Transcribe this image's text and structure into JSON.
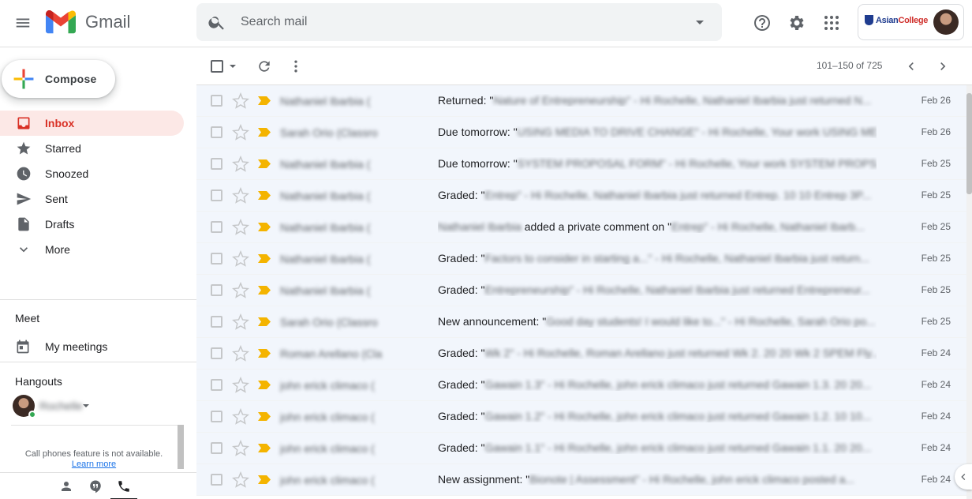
{
  "header": {
    "app_name": "Gmail",
    "search_placeholder": "Search mail",
    "org_logo_blue": "Asian",
    "org_logo_red": "College"
  },
  "sidebar": {
    "compose_label": "Compose",
    "items": [
      {
        "label": "Inbox",
        "icon": "inbox-icon",
        "active": true
      },
      {
        "label": "Starred",
        "icon": "star-icon"
      },
      {
        "label": "Snoozed",
        "icon": "clock-icon"
      },
      {
        "label": "Sent",
        "icon": "send-icon"
      },
      {
        "label": "Drafts",
        "icon": "draft-icon"
      },
      {
        "label": "More",
        "icon": "chevron-down-icon"
      }
    ],
    "meet_title": "Meet",
    "meet_item": "My meetings",
    "hangouts_title": "Hangouts",
    "hangouts_user": "Rochelle",
    "phone_message": "Call phones feature is not available.",
    "phone_link": "Learn more"
  },
  "toolbar": {
    "pagination": "101–150 of 725"
  },
  "emails": [
    {
      "sender": "Nathaniel Ibarbia (",
      "prefix": "Returned: \"",
      "blurred": "Nature of Entrepreneurship\" - Hi Rochelle, Nathaniel Ibarbia just returned N...",
      "suffix": "",
      "date": "Feb 26"
    },
    {
      "sender": "Sarah Orio (Classro",
      "prefix": "Due tomorrow: \"",
      "blurred": "USING MEDIA TO DRIVE CHANGE\" - Hi Rochelle, Your work USING ME...",
      "suffix": "",
      "date": "Feb 26"
    },
    {
      "sender": "Nathaniel Ibarbia (",
      "prefix": "Due tomorrow: \"",
      "blurred": "SYSTEM PROPOSAL FORM\" - Hi Rochelle, Your work SYSTEM PROPS...",
      "suffix": "",
      "date": "Feb 25"
    },
    {
      "sender": "Nathaniel Ibarbia (",
      "prefix": "Graded: \"",
      "blurred": "Entrep\" - Hi Rochelle, Nathaniel Ibarbia just returned Entrep. 10 10 Entrep 3P...",
      "suffix": "",
      "date": "Feb 25"
    },
    {
      "sender": "Nathaniel Ibarbia (",
      "prefix": "",
      "blurred": "Nathaniel Ibarbia",
      "suffix": " added a private comment on \"",
      "tail": "Entrep\" - Hi Rochelle, Nathaniel Ibarb...",
      "date": "Feb 25"
    },
    {
      "sender": "Nathaniel Ibarbia (",
      "prefix": "Graded: \"",
      "blurred": "Factors to consider in starting a...\" - Hi Rochelle, Nathaniel Ibarbia just return...",
      "suffix": "",
      "date": "Feb 25"
    },
    {
      "sender": "Nathaniel Ibarbia (",
      "prefix": "Graded: \"",
      "blurred": "Entrepreneurship\" - Hi Rochelle, Nathaniel Ibarbia just returned Entrepreneur...",
      "suffix": "",
      "date": "Feb 25"
    },
    {
      "sender": "Sarah Orio (Classro",
      "prefix": "New announcement: \"",
      "blurred": "Good day students! I would like to...\" - Hi Rochelle, Sarah Orio po...",
      "suffix": "",
      "date": "Feb 25"
    },
    {
      "sender": "Roman Arellano (Cla",
      "prefix": "Graded: \"",
      "blurred": "Wk 2\" - Hi Rochelle, Roman Arellano just returned Wk 2. 20 20 Wk 2 SPEM Fly...",
      "suffix": "",
      "date": "Feb 24"
    },
    {
      "sender": "john erick climaco (",
      "prefix": "Graded: \"",
      "blurred": "Gawain 1.3\" - Hi Rochelle, john erick climaco just returned Gawain 1.3. 20 20...",
      "suffix": "",
      "date": "Feb 24"
    },
    {
      "sender": "john erick climaco (",
      "prefix": "Graded: \"",
      "blurred": "Gawain 1.2\" - Hi Rochelle, john erick climaco just returned Gawain 1.2. 10 10...",
      "suffix": "",
      "date": "Feb 24"
    },
    {
      "sender": "john erick climaco (",
      "prefix": "Graded: \"",
      "blurred": "Gawain 1.1\" - Hi Rochelle, john erick climaco just returned Gawain 1.1. 20 20...",
      "suffix": "",
      "date": "Feb 24"
    },
    {
      "sender": "john erick climaco (",
      "prefix": "New assignment: \"",
      "blurred": "Bionote | Assessment\" - Hi Rochelle, john erick climaco posted a...",
      "suffix": "",
      "date": "Feb 24"
    }
  ],
  "colors": {
    "active_bg": "#fce8e6",
    "active_text": "#d93025",
    "important_marker": "#f4b400",
    "row_bg": "#f2f6fc"
  }
}
